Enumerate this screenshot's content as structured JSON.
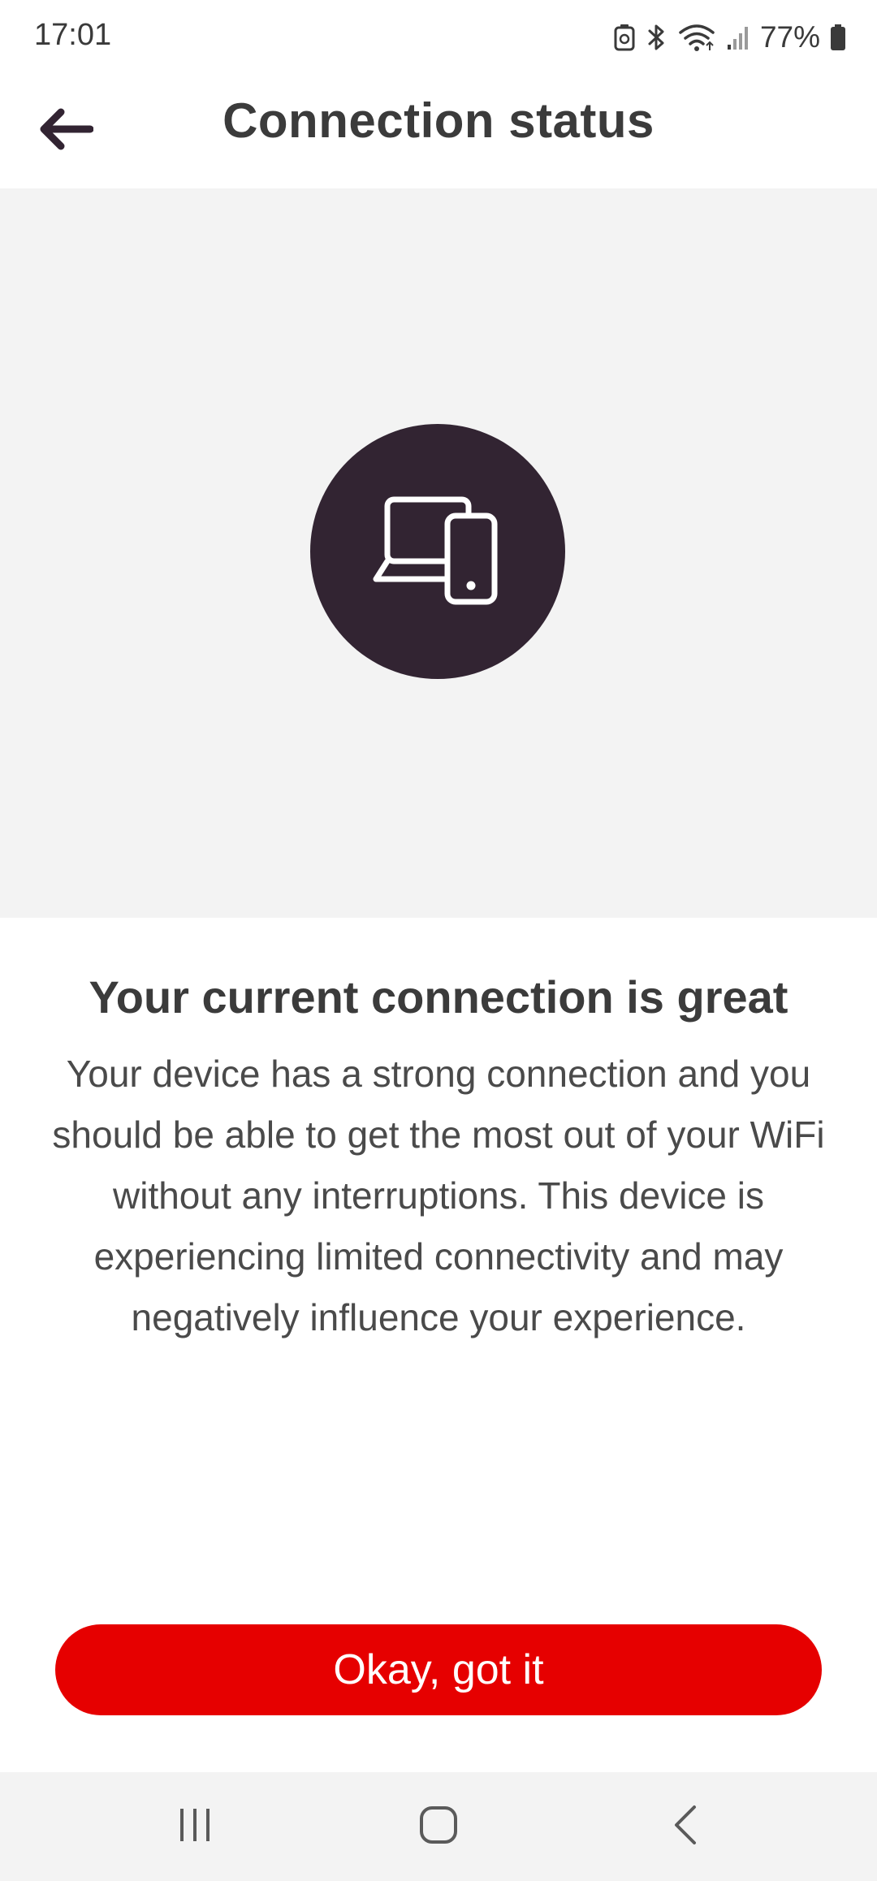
{
  "status_bar": {
    "time": "17:01",
    "battery_percent": "77%",
    "icons": [
      "battery-saver-icon",
      "bluetooth-icon",
      "wifi-icon",
      "cellular-signal-icon",
      "battery-icon"
    ]
  },
  "header": {
    "title": "Connection status",
    "back_icon": "arrow-left-icon"
  },
  "hero": {
    "icon": "laptop-phone-icon",
    "circle_color": "#322432",
    "background": "#f3f3f3"
  },
  "content": {
    "headline": "Your current connection is great",
    "body": "Your device has a strong connection and you should be able to get the most out of your WiFi without any interruptions. This device is experiencing limited connectivity and may negatively influence your experience."
  },
  "actions": {
    "primary_label": "Okay, got it",
    "primary_color": "#e60000"
  },
  "nav_bar": {
    "icons": [
      "recent-apps-icon",
      "home-icon",
      "back-icon"
    ]
  }
}
